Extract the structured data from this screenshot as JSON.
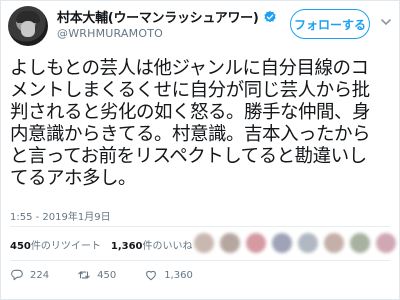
{
  "header": {
    "display_name": "村本大輔(ウーマンラッシュアワー)",
    "handle": "@WRHMURAMOTO",
    "follow_label": "フォローする"
  },
  "tweet": {
    "lines": [
      "よしもとの芸人は他ジャンルに自分目線のコ",
      "メントしまくるくせに自分が同じ芸人から批",
      "判されると劣化の如く怒る。勝手な仲間、身",
      "内意識からきてる。村意識。吉本入ったから",
      "と言ってお前をリスペクトしてると勘違いし",
      "てるアホ多し。"
    ],
    "timestamp": "1:55 - 2019年1月9日"
  },
  "stats": {
    "retweet_count": "450",
    "retweet_label": "件のリツイート",
    "like_count": "1,360",
    "like_label": "件のいいね",
    "liker_colors": [
      "#c9b8b0",
      "#b5a7a0",
      "#d69aa3",
      "#9fa3b8",
      "#b0b8c2",
      "#c4b0a8",
      "#a8b2a0",
      "#d0a8b4"
    ]
  },
  "actions": {
    "reply_count": "224",
    "retweet_count": "450",
    "like_count": "1,360"
  },
  "colors": {
    "accent": "#1da1f2",
    "muted": "#657786",
    "text": "#14171a"
  }
}
